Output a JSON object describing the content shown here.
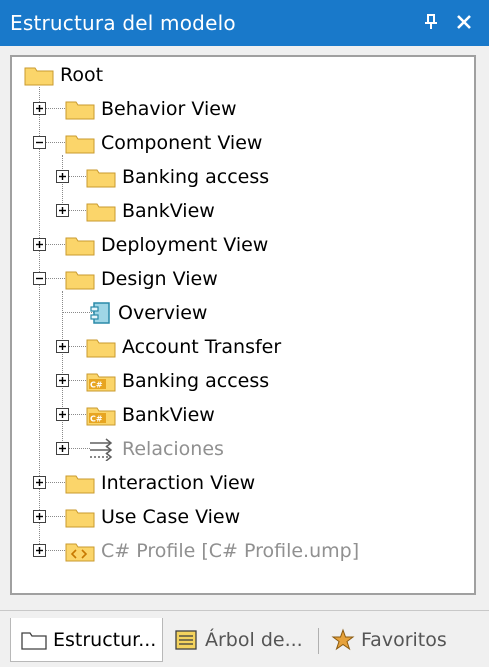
{
  "window": {
    "title": "Estructura del modelo",
    "titlebar_color": "#1979ca",
    "pin_icon": "pin-icon",
    "close_icon": "close-icon"
  },
  "tree": {
    "root": "Root",
    "items": {
      "behavior_view": "Behavior View",
      "component_view": "Component View",
      "banking_access_1": "Banking access",
      "bankview_1": "BankView",
      "deployment_view": "Deployment View",
      "design_view": "Design View",
      "overview": "Overview",
      "account_transfer": "Account Transfer",
      "banking_access_2": "Banking access",
      "bankview_2": "BankView",
      "relaciones": "Relaciones",
      "interaction_view": "Interaction View",
      "use_case_view": "Use Case View",
      "csharp_profile": "C# Profile [C# Profile.ump]"
    }
  },
  "tabs": {
    "structure": "Estructur...",
    "diagram_tree": "Árbol de...",
    "favorites": "Favoritos"
  }
}
